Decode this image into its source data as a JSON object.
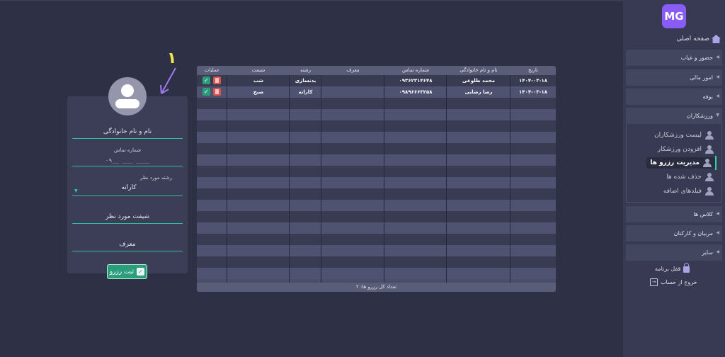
{
  "sidebar": {
    "logo_text": "MG",
    "home_label": "صفحه اصلی",
    "menu": [
      {
        "label": "حضور و غیاب"
      },
      {
        "label": "امور مالی"
      },
      {
        "label": "بوفه"
      },
      {
        "label": "ورزشکاران"
      },
      {
        "label": "کلاس ها"
      },
      {
        "label": "مربیان و کارکنان"
      },
      {
        "label": "سایر"
      }
    ],
    "athletes_submenu": [
      {
        "label": "لیست ورزشکاران"
      },
      {
        "label": "افزودن ورزشکار"
      },
      {
        "label": "مدیریت رزرو ها"
      },
      {
        "label": "حذف شده ها"
      },
      {
        "label": "فیلدهای اضافه"
      }
    ],
    "lock_label": "قفل برنامه",
    "logout_label": "خروج از حساب"
  },
  "form": {
    "annotation": "۱",
    "full_name_placeholder": "نام و نام خانوادگی",
    "phone_label": "شماره تماس",
    "phone_value": "۰۹__ ___ ____",
    "field_label": "رشته مورد نظر",
    "field_value": "کاراته",
    "shift_placeholder": "شیفت مورد نظر",
    "referrer_placeholder": "معرف",
    "submit_label": "ثبت رزرو"
  },
  "table": {
    "headers": {
      "date": "تاریخ",
      "name": "نام و نام خانوادگی",
      "phone": "شماره تماس",
      "referrer": "معرف",
      "field": "رشته",
      "shift": "شیفت",
      "actions": "عملیات"
    },
    "rows": [
      {
        "date": "۱۴۰۴-۰۳-۱۸",
        "name": "محمد طلوعی",
        "phone": "۰۹۳۶۲۳۱۴۶۴۸",
        "referrer": "",
        "field": "بدنسازی",
        "shift": "شب"
      },
      {
        "date": "۱۴۰۴-۰۳-۱۸",
        "name": "رضا رضایی",
        "phone": "۰۹۸۹۶۶۶۳۲۵۸",
        "referrer": "",
        "field": "کاراته",
        "shift": "صبح"
      }
    ],
    "total_label": "تعداد کل رزرو ها:",
    "total_value": "۲"
  },
  "colors": {
    "accent": "#2fd5a7",
    "brand": "#8a5cf6",
    "delete": "#d9534f",
    "annotation": "#f5e84a",
    "arrow": "#9b7cf0"
  }
}
